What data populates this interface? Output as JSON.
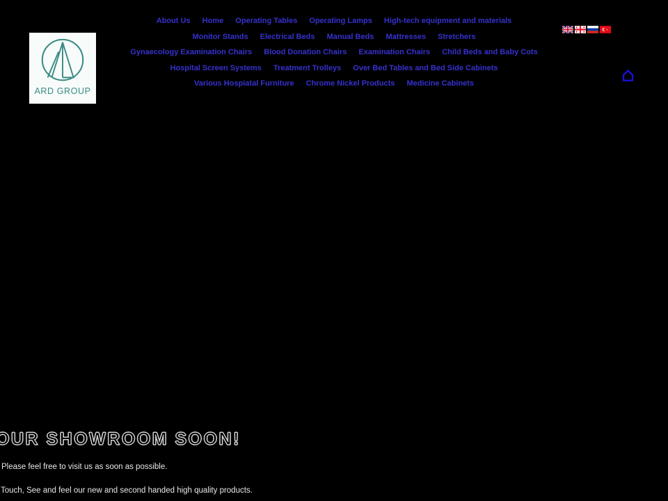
{
  "colors": {
    "background": "#000000",
    "nav_link": "#3631cd",
    "logo_teal": "#3b8b83",
    "logo_panel": "#f7fbfa",
    "home_icon": "#1a10e0",
    "body_text": "#e8e8e8"
  },
  "logo": {
    "name": "ARD GROUP",
    "icon": "ard-group-circle-peak-logo"
  },
  "nav": {
    "items": [
      {
        "label": "About Us"
      },
      {
        "label": "Home"
      },
      {
        "label": "Operating Tables"
      },
      {
        "label": "Operating Lamps"
      },
      {
        "label": "High-tech equipment and materials"
      },
      {
        "label": "Monitor Stands"
      },
      {
        "label": "Electrical Beds"
      },
      {
        "label": "Manual Beds"
      },
      {
        "label": "Mattresses"
      },
      {
        "label": "Stretchers"
      },
      {
        "label": "Gynaecology Examination Chairs"
      },
      {
        "label": "Blood Donation Chairs"
      },
      {
        "label": "Examination Chairs"
      },
      {
        "label": "Child Beds and Baby Cots"
      },
      {
        "label": "Hospital Screen Systems"
      },
      {
        "label": "Treatment Trolleys"
      },
      {
        "label": "Over Bed Tables and Bed Side Cabinets"
      },
      {
        "label": "Various Hospiatal Furniture"
      },
      {
        "label": "Chrome Nickel Products"
      },
      {
        "label": "Medicine Cabinets"
      }
    ]
  },
  "languages": [
    {
      "name": "english-flag",
      "title": "English"
    },
    {
      "name": "georgian-flag",
      "title": "Georgian"
    },
    {
      "name": "russian-flag",
      "title": "Russian"
    },
    {
      "name": "turkish-flag",
      "title": "Turkish"
    }
  ],
  "home_icon": {
    "name": "home-icon"
  },
  "promo": {
    "heading": "OUR SHOWROOM SOON!",
    "line_1": "Please feel free to visit us as soon as possible.",
    "line_2": "Touch, See and feel our new and second handed high quality products."
  }
}
